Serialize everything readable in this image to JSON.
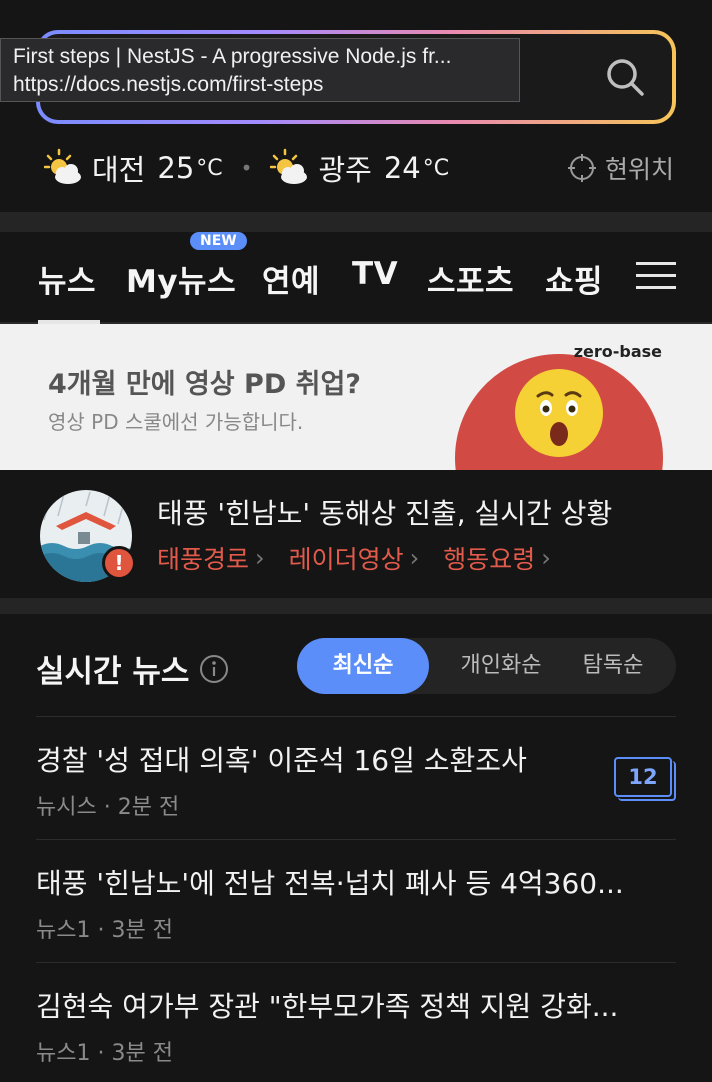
{
  "tooltip": {
    "title": "First steps | NestJS - A progressive Node.js fr...",
    "url": "https://docs.nestjs.com/first-steps"
  },
  "search": {
    "icon": "search-icon",
    "accent_gradient": [
      "#7a8cff",
      "#e98ab0",
      "#f6c458"
    ]
  },
  "weather": [
    {
      "city": "대전",
      "temp": "25",
      "unit": "°C",
      "icon": "partly-cloudy-icon"
    },
    {
      "city": "광주",
      "temp": "24",
      "unit": "°C",
      "icon": "partly-cloudy-icon"
    }
  ],
  "location_label": "현위치",
  "nav": {
    "tabs": [
      "뉴스",
      "My뉴스",
      "연예",
      "TV",
      "스포츠",
      "쇼핑"
    ],
    "active": "뉴스",
    "new_badge": "NEW"
  },
  "ad": {
    "title": "4개월 만에 영상 PD 취업?",
    "subtitle": "영상 PD 스쿨에선 가능합니다.",
    "brand": "zero-base"
  },
  "alert": {
    "title": "태풍 '힌남노' 동해상 진출, 실시간 상황",
    "links": [
      "태풍경로",
      "레이더영상",
      "행동요령"
    ],
    "link_color": "#e25a4a"
  },
  "realtime": {
    "heading": "실시간 뉴스",
    "sort_options": [
      "최신순",
      "개인화순",
      "탐독순"
    ],
    "active_sort": "최신순",
    "accent": "#5b8ef8",
    "items": [
      {
        "title": "경찰 '성 접대 의혹' 이준석 16일 소환조사",
        "source": "뉴시스",
        "time": "2분 전",
        "count": "12"
      },
      {
        "title": "태풍 '힌남노'에 전남 전복·넙치 폐사 등 4억360...",
        "source": "뉴스1",
        "time": "3분 전"
      },
      {
        "title": "김현숙 여가부 장관 \"한부모가족 정책 지원 강화...",
        "source": "뉴스1",
        "time": "3분 전"
      }
    ]
  }
}
